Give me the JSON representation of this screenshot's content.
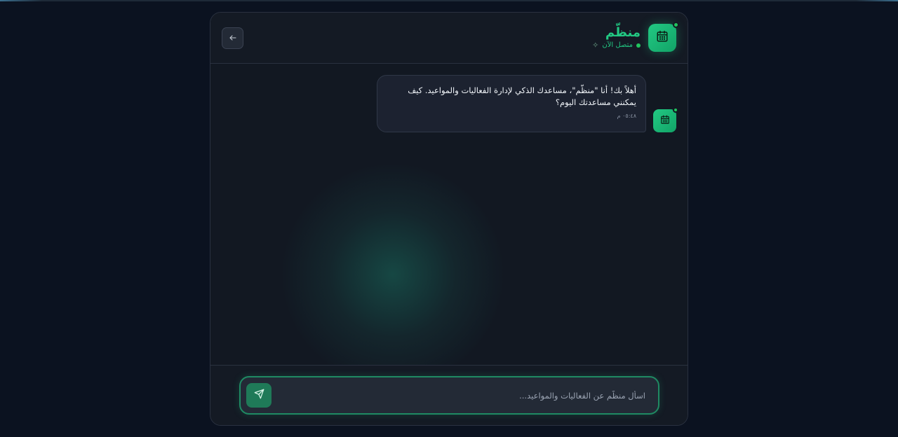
{
  "header": {
    "title": "منظّم",
    "status": "متصل الآن",
    "status_icon": "sparkle-icon",
    "avatar_icon": "calendar-icon",
    "back_icon": "arrow-left-icon"
  },
  "messages": [
    {
      "sender": "bot",
      "text": "أهلاً بك! أنا \"منظّم\"، مساعدك الذكي لإدارة الفعاليات والمواعيد. كيف يمكنني مساعدتك اليوم؟",
      "time": "٠٥:٤٨ م"
    }
  ],
  "composer": {
    "placeholder": "اسأل منظّم عن الفعاليات والمواعيد...",
    "send_icon": "send-icon"
  },
  "colors": {
    "accent": "#22c983",
    "background": "#0b1220",
    "panel": "#121822"
  }
}
